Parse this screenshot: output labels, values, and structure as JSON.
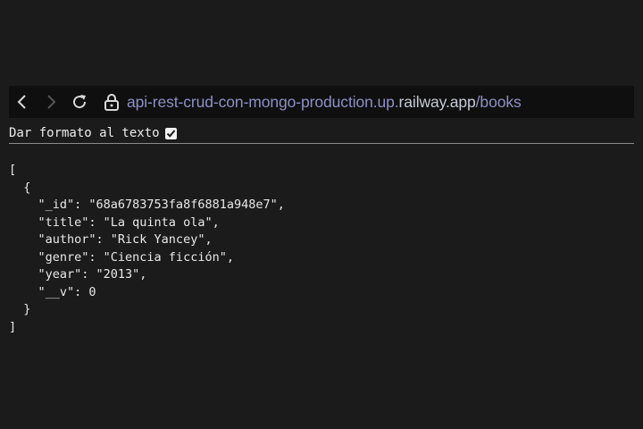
{
  "browser": {
    "url_path": "api-rest-crud-con-mongo-production.up.",
    "url_host": "railway.app",
    "url_tail": "/books",
    "icons": [
      "back-icon",
      "forward-icon",
      "reload-icon",
      "lock-icon"
    ]
  },
  "pretty_print": {
    "label": "Dar formato al texto",
    "checked": true
  },
  "json_lines": [
    "[",
    "  {",
    "    \"_id\": \"68a6783753fa8f6881a948e7\",",
    "    \"title\": \"La quinta ola\",",
    "    \"author\": \"Rick Yancey\",",
    "    \"genre\": \"Ciencia ficción\",",
    "    \"year\": \"2013\",",
    "    \"__v\": 0",
    "  }",
    "]"
  ],
  "colors": {
    "background": "#1b1b1b",
    "toolbar": "#0f0f0f",
    "url": "#8d90c7",
    "text": "#e9e9e9"
  }
}
